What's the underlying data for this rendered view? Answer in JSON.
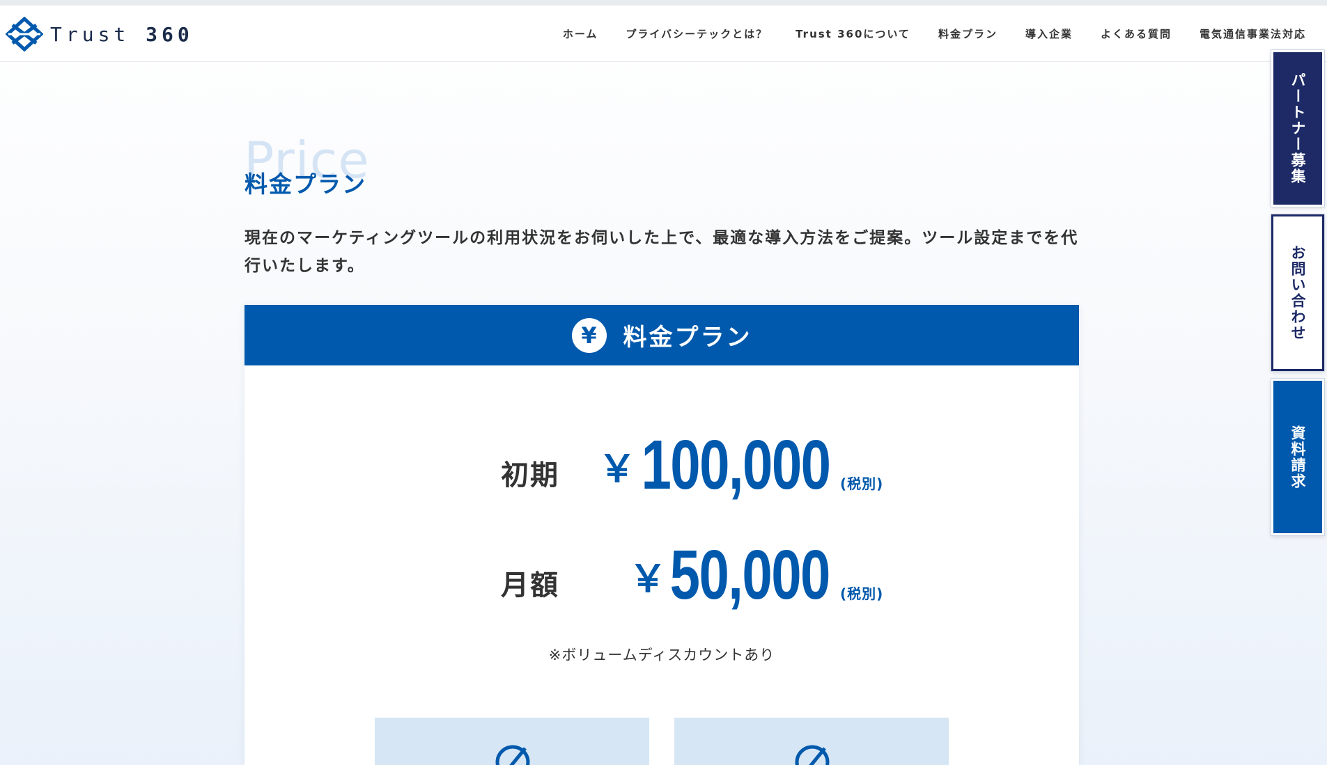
{
  "header": {
    "logo_text_light": "Trust",
    "logo_text_bold": "360",
    "nav": [
      "ホーム",
      "プライバシーテックとは？",
      "Trust 360について",
      "料金プラン",
      "導入企業",
      "よくある質問",
      "電気通信事業法対応"
    ]
  },
  "side_tabs": {
    "partner": "パートナー募集",
    "contact": "お問い合わせ",
    "docs": "資料請求"
  },
  "section": {
    "bg_title": "Price",
    "title": "料金プラン",
    "intro": "現在のマーケティングツールの利用状況をお伺いした上で、最適な導入方法をご提案。ツール設定までを代行いたします。"
  },
  "price_card": {
    "header_icon": "¥",
    "header_title": "料金プラン",
    "initial": {
      "label": "初期",
      "yen": "￥",
      "amount": "100,000",
      "tax": "(税別)"
    },
    "monthly": {
      "label": "月額",
      "yen": "￥",
      "amount": "50,000",
      "tax": "(税別)"
    },
    "discount_note": "※ボリュームディスカウントあり"
  },
  "colors": {
    "brand_blue": "#0059ac",
    "navy": "#1d2a66",
    "light_blue_box": "#d6e6f4"
  }
}
